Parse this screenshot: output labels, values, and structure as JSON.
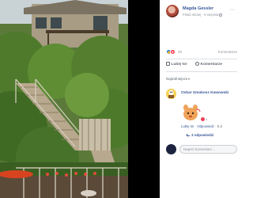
{
  "post": {
    "author_name": "Magda Gessler",
    "author_meta": "Polub stronę · 8 sierpnia",
    "more_label": "···"
  },
  "reactions": {
    "count": "20",
    "comments_link": "Komentarze"
  },
  "actions": {
    "like_label": "Lubię to!",
    "comment_label": "Komentarze"
  },
  "comments": {
    "sort_label": "Najtrafniejsze",
    "items": [
      {
        "author": "Oskar Smakosz Kawowski",
        "reaction_count": "1",
        "like_link": "Lubię to!",
        "reply_link": "Odpowiedz",
        "time": "5 d",
        "replies_label": "3 odpowiedzi"
      }
    ],
    "write_placeholder": "Napisz komentarz..."
  },
  "colors": {
    "link": "#385898",
    "like_blue": "#1877f2",
    "love_red": "#f33e58"
  }
}
